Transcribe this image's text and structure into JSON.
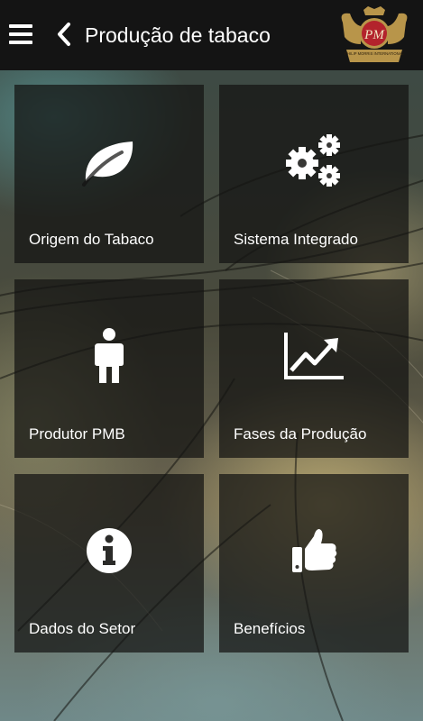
{
  "header": {
    "title": "Produção de tabaco",
    "menu_icon": "hamburger-menu-icon",
    "back_icon": "chevron-left-icon",
    "logo_initials": "PM",
    "logo_text": "PHILIP MORRIS INTERNATIONAL",
    "bar_color": "#141414"
  },
  "tiles": [
    {
      "label": "Origem do Tabaco",
      "icon": "leaf-icon"
    },
    {
      "label": "Sistema Integrado",
      "icon": "gears-icon"
    },
    {
      "label": "Produtor PMB",
      "icon": "person-icon"
    },
    {
      "label": "Fases da Produção",
      "icon": "trending-up-chart-icon"
    },
    {
      "label": "Dados do Setor",
      "icon": "info-icon"
    },
    {
      "label": "Benefícios",
      "icon": "thumbs-up-icon"
    }
  ],
  "colors": {
    "tile_background": "rgba(20,20,18,0.72)",
    "text": "#ffffff",
    "logo_gold": "#b8954a",
    "logo_red": "#b3232c"
  }
}
